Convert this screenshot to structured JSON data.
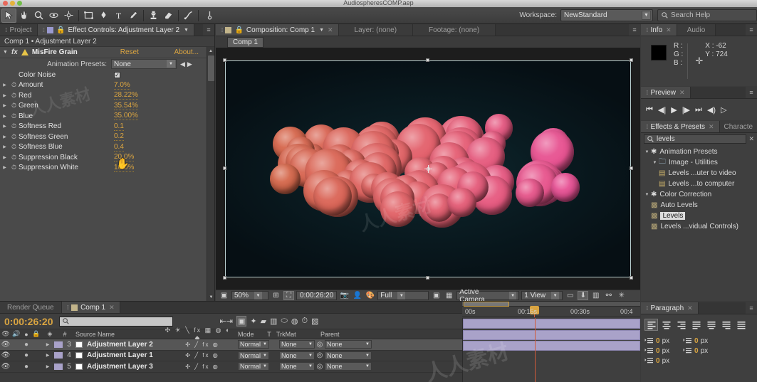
{
  "window": {
    "title": "AudiospheresCOMP.aep"
  },
  "toolbar": {
    "workspace_label": "Workspace:",
    "workspace_value": "NewStandard",
    "search_placeholder": "Search Help",
    "search_icon": "search-icon",
    "tools": [
      {
        "name": "selection-tool",
        "glyph": "➤",
        "selected": true
      },
      {
        "name": "hand-tool",
        "glyph": "✋",
        "selected": false
      },
      {
        "name": "zoom-tool",
        "glyph": "⌕",
        "selected": false
      },
      {
        "name": "orbit-camera-tool",
        "glyph": "↻",
        "selected": false
      },
      {
        "name": "pan-behind-tool",
        "glyph": "✥",
        "selected": false
      },
      {
        "name": "shape-tool",
        "glyph": "▣",
        "selected": false
      },
      {
        "name": "pen-tool",
        "glyph": "✒",
        "selected": false
      },
      {
        "name": "type-tool",
        "glyph": "T",
        "selected": false
      },
      {
        "name": "brush-tool",
        "glyph": "✎",
        "selected": false
      },
      {
        "name": "clone-stamp-tool",
        "glyph": "⎙",
        "selected": false
      },
      {
        "name": "eraser-tool",
        "glyph": "▰",
        "selected": false
      },
      {
        "name": "roto-brush-tool",
        "glyph": "↗",
        "selected": false
      },
      {
        "name": "puppet-pin-tool",
        "glyph": "⊕",
        "selected": false
      }
    ]
  },
  "effect_controls": {
    "tabs": [
      {
        "label": "Project",
        "active": false
      },
      {
        "label": "Effect Controls: Adjustment Layer 2",
        "active": true
      }
    ],
    "header": "Comp 1 • Adjustment Layer 2",
    "effect_name": "MisFire Grain",
    "reset_label": "Reset",
    "about_label": "About...",
    "animation_presets_label": "Animation Presets:",
    "animation_presets_value": "None",
    "properties": [
      {
        "name": "Color Noise",
        "value": "",
        "type": "checkbox",
        "checked": true
      },
      {
        "name": "Amount",
        "value": "7.0%",
        "type": "value"
      },
      {
        "name": "Red",
        "value": "28.22%",
        "type": "value"
      },
      {
        "name": "Green",
        "value": "35.54%",
        "type": "value"
      },
      {
        "name": "Blue",
        "value": "35.00%",
        "type": "value"
      },
      {
        "name": "Softness Red",
        "value": "0.1",
        "type": "value"
      },
      {
        "name": "Softness Green",
        "value": "0.2",
        "type": "value"
      },
      {
        "name": "Softness Blue",
        "value": "0.4",
        "type": "value"
      },
      {
        "name": "Suppression Black",
        "value": "20.0%",
        "type": "value"
      },
      {
        "name": "Suppression White",
        "value": "10.0%",
        "type": "value"
      }
    ]
  },
  "composition": {
    "tabs": [
      {
        "label": "Composition: Comp 1",
        "active": true
      },
      {
        "label": "Layer: (none)",
        "active": false
      },
      {
        "label": "Footage: (none)",
        "active": false
      }
    ],
    "breadcrumb": "Comp 1",
    "viewer_bar": {
      "zoom": "50%",
      "timecode": "0:00:26:20",
      "resolution": "Full",
      "camera": "Active Camera",
      "views": "1 View"
    },
    "artwork": {
      "background": "#0a1c22",
      "sphere_color_left": "#d4684a",
      "sphere_color_mid": "#e4616e",
      "sphere_color_right": "#e8509a"
    }
  },
  "info": {
    "tabs": [
      {
        "label": "Info",
        "active": true
      },
      {
        "label": "Audio",
        "active": false
      }
    ],
    "r_label": "R :",
    "g_label": "G :",
    "b_label": "B :",
    "r_value": "",
    "g_value": "",
    "b_value": "",
    "x_label": "X :",
    "x_value": "-62",
    "y_label": "Y :",
    "y_value": "724"
  },
  "preview": {
    "tabs": [
      {
        "label": "Preview",
        "active": true
      }
    ],
    "buttons": [
      {
        "name": "first-frame-button",
        "glyph": "⏮"
      },
      {
        "name": "previous-frame-button",
        "glyph": "◀|"
      },
      {
        "name": "play-button",
        "glyph": "▶"
      },
      {
        "name": "next-frame-button",
        "glyph": "|▶"
      },
      {
        "name": "last-frame-button",
        "glyph": "⏭"
      },
      {
        "name": "audio-button",
        "glyph": "◀)"
      },
      {
        "name": "ram-preview-button",
        "glyph": "▷"
      }
    ]
  },
  "effects_presets": {
    "tabs": [
      {
        "label": "Effects & Presets",
        "active": true
      },
      {
        "label": "Characte",
        "active": false
      }
    ],
    "search_value": "levels",
    "tree": [
      {
        "label": "Animation Presets",
        "depth": 0,
        "type": "group",
        "expanded": true,
        "selected": false
      },
      {
        "label": "Image - Utilities",
        "depth": 1,
        "type": "folder",
        "expanded": true,
        "selected": false
      },
      {
        "label": "Levels ...uter to video",
        "depth": 2,
        "type": "preset",
        "selected": false
      },
      {
        "label": "Levels ...to computer",
        "depth": 2,
        "type": "preset",
        "selected": false
      },
      {
        "label": "Color Correction",
        "depth": 0,
        "type": "group",
        "expanded": true,
        "selected": false
      },
      {
        "label": "Auto Levels",
        "depth": 1,
        "type": "effect",
        "selected": false
      },
      {
        "label": "Levels",
        "depth": 1,
        "type": "effect",
        "selected": true
      },
      {
        "label": "Levels ...vidual Controls)",
        "depth": 1,
        "type": "effect",
        "selected": false
      }
    ]
  },
  "paragraph": {
    "tabs": [
      {
        "label": "Paragraph",
        "active": true
      }
    ],
    "align_buttons": [
      {
        "name": "align-left-button",
        "active": true
      },
      {
        "name": "align-center-button",
        "active": false
      },
      {
        "name": "align-right-button",
        "active": false
      },
      {
        "name": "justify-last-left-button",
        "active": false
      },
      {
        "name": "justify-last-center-button",
        "active": false
      },
      {
        "name": "justify-last-right-button",
        "active": false
      },
      {
        "name": "justify-all-button",
        "active": false
      }
    ],
    "fields": [
      {
        "name": "indent-left",
        "value": "0",
        "unit": "px"
      },
      {
        "name": "space-before",
        "value": "0",
        "unit": "px"
      },
      {
        "name": "indent-right",
        "value": "0",
        "unit": "px"
      },
      {
        "name": "first-line-indent",
        "value": "0",
        "unit": "px"
      },
      {
        "name": "space-after",
        "value": "0",
        "unit": "px"
      }
    ]
  },
  "timeline": {
    "tabs": [
      {
        "label": "Render Queue",
        "active": false
      },
      {
        "label": "Comp 1",
        "active": true
      }
    ],
    "timecode": "0:00:26:20",
    "search_placeholder": "",
    "columns": {
      "source_name": "Source Name",
      "mode": "Mode",
      "t": "T",
      "trkmat": "TrkMat",
      "parent": "Parent"
    },
    "layers": [
      {
        "index": "3",
        "name": "Adjustment Layer 2",
        "mode": "Normal",
        "trkmat": "None",
        "parent": "None",
        "selected": true
      },
      {
        "index": "4",
        "name": "Adjustment Layer 1",
        "mode": "Normal",
        "trkmat": "None",
        "parent": "None",
        "selected": false
      },
      {
        "index": "5",
        "name": "Adjustment Layer 3",
        "mode": "Normal",
        "trkmat": "None",
        "parent": "None",
        "selected": false
      }
    ],
    "ruler_ticks": [
      "00s",
      "00:15s",
      "00:30s",
      "00:4"
    ]
  }
}
